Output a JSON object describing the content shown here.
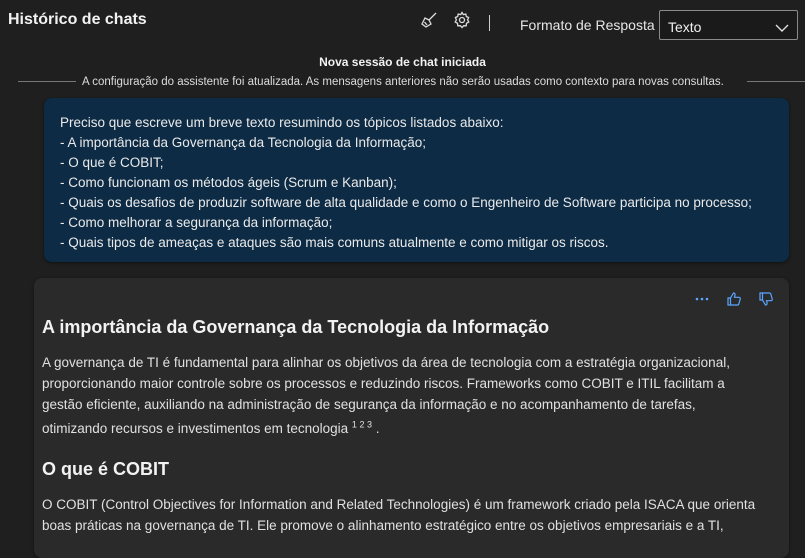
{
  "header": {
    "title": "Histórico de chats",
    "separator": "|",
    "format_label": "Formato de Resposta",
    "format_value": "Texto"
  },
  "session": {
    "title": "Nova sessão de chat iniciada",
    "note": "A configuração do assistente foi atualizada. As mensagens anteriores não serão usadas como contexto para novas consultas."
  },
  "user_message": {
    "lines": [
      "Preciso que escreve um breve texto resumindo os tópicos listados abaixo:",
      "- A importância da Governança da Tecnologia da Informação;",
      "- O que é COBIT;",
      "- Como funcionam os métodos ágeis (Scrum e Kanban);",
      "- Quais os desafios de produzir software de alta qualidade e como o Engenheiro de Software participa no processo;",
      "- Como melhorar a segurança da informação;",
      "- Quais tipos de ameaças e ataques são mais comuns atualmente e como mitigar os riscos."
    ]
  },
  "response": {
    "actions": [
      "more-options",
      "thumbs-up",
      "thumbs-down"
    ],
    "section1": {
      "heading": "A importância da Governança da Tecnologia da Informação",
      "lines": [
        "A governança de TI é fundamental para alinhar os objetivos da área de tecnologia com a estratégia organizacional,",
        "proporcionando maior controle sobre os processos e reduzindo riscos. Frameworks como COBIT e ITIL facilitam a",
        "gestão eficiente, auxiliando na administração de segurança da informação e no acompanhamento de tarefas,"
      ],
      "last_line": "otimizando recursos e investimentos em tecnologia",
      "citations": [
        "1",
        "2",
        "3"
      ],
      "end": "."
    },
    "section2": {
      "heading": "O que é COBIT",
      "lines": [
        "O COBIT (Control Objectives for Information and Related Technologies) é um framework criado pela ISACA que orienta",
        "boas práticas na governança de TI. Ele promove o alinhamento estratégico entre os objetivos empresariais e a TI,"
      ]
    }
  },
  "colors": {
    "background": "#1f1f1f",
    "user_bubble": "#0d2b44",
    "response_card": "#2a2a2a",
    "accent": "#5aa6ff"
  }
}
